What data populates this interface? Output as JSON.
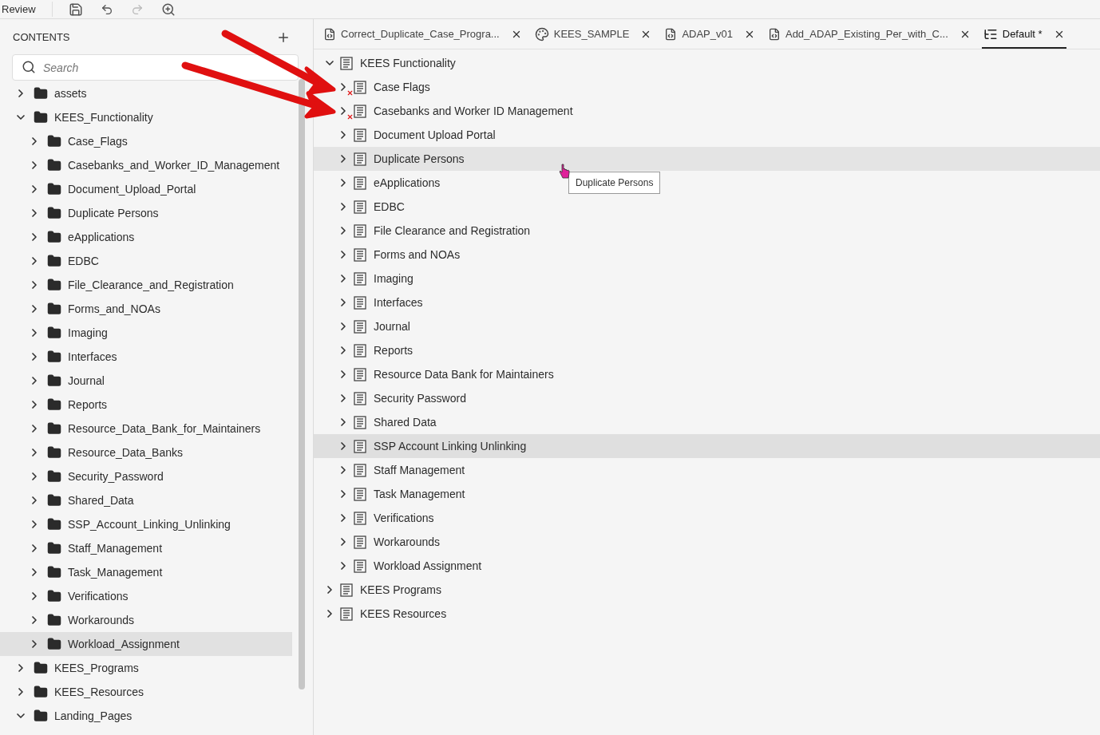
{
  "toolbar": {
    "label": "Review"
  },
  "contents": {
    "title": "CONTENTS",
    "search": {
      "placeholder": "Search"
    },
    "tree": [
      {
        "label": "assets",
        "expanded": false,
        "selected": false
      },
      {
        "label": "KEES_Functionality",
        "expanded": true,
        "selected": false,
        "children": [
          {
            "label": "Case_Flags",
            "expanded": false,
            "selected": false
          },
          {
            "label": "Casebanks_and_Worker_ID_Management",
            "expanded": false,
            "selected": false
          },
          {
            "label": "Document_Upload_Portal",
            "expanded": false,
            "selected": false
          },
          {
            "label": "Duplicate Persons",
            "expanded": false,
            "selected": false
          },
          {
            "label": "eApplications",
            "expanded": false,
            "selected": false
          },
          {
            "label": "EDBC",
            "expanded": false,
            "selected": false
          },
          {
            "label": "File_Clearance_and_Registration",
            "expanded": false,
            "selected": false
          },
          {
            "label": "Forms_and_NOAs",
            "expanded": false,
            "selected": false
          },
          {
            "label": "Imaging",
            "expanded": false,
            "selected": false
          },
          {
            "label": "Interfaces",
            "expanded": false,
            "selected": false
          },
          {
            "label": "Journal",
            "expanded": false,
            "selected": false
          },
          {
            "label": "Reports",
            "expanded": false,
            "selected": false
          },
          {
            "label": "Resource_Data_Bank_for_Maintainers",
            "expanded": false,
            "selected": false
          },
          {
            "label": "Resource_Data_Banks",
            "expanded": false,
            "selected": false
          },
          {
            "label": "Security_Password",
            "expanded": false,
            "selected": false
          },
          {
            "label": "Shared_Data",
            "expanded": false,
            "selected": false
          },
          {
            "label": "SSP_Account_Linking_Unlinking",
            "expanded": false,
            "selected": false
          },
          {
            "label": "Staff_Management",
            "expanded": false,
            "selected": false
          },
          {
            "label": "Task_Management",
            "expanded": false,
            "selected": false
          },
          {
            "label": "Verifications",
            "expanded": false,
            "selected": false
          },
          {
            "label": "Workarounds",
            "expanded": false,
            "selected": false
          },
          {
            "label": "Workload_Assignment",
            "expanded": false,
            "selected": true
          }
        ]
      },
      {
        "label": "KEES_Programs",
        "expanded": false,
        "selected": false
      },
      {
        "label": "KEES_Resources",
        "expanded": false,
        "selected": false
      },
      {
        "label": "Landing_Pages",
        "expanded": true,
        "selected": false
      }
    ]
  },
  "tabs": [
    {
      "label": "Correct_Duplicate_Case_Progra...",
      "kind": "html",
      "selected": false
    },
    {
      "label": "KEES_SAMPLE",
      "kind": "style",
      "selected": false
    },
    {
      "label": "ADAP_v01",
      "kind": "html",
      "selected": false
    },
    {
      "label": "Add_ADAP_Existing_Per_with_C...",
      "kind": "html",
      "selected": false
    },
    {
      "label": "Default *",
      "kind": "toc",
      "selected": true
    }
  ],
  "toc_tree": [
    {
      "label": "KEES Functionality",
      "expanded": true,
      "selected": false,
      "hovered": false,
      "error": false,
      "children": [
        {
          "label": "Case Flags",
          "expanded": false,
          "selected": false,
          "hovered": false,
          "error": true
        },
        {
          "label": "Casebanks and Worker ID Management",
          "expanded": false,
          "selected": false,
          "hovered": false,
          "error": true
        },
        {
          "label": "Document Upload Portal",
          "expanded": false,
          "selected": false,
          "hovered": false,
          "error": false
        },
        {
          "label": "Duplicate Persons",
          "expanded": false,
          "selected": false,
          "hovered": true,
          "error": false
        },
        {
          "label": "eApplications",
          "expanded": false,
          "selected": false,
          "hovered": false,
          "error": false
        },
        {
          "label": "EDBC",
          "expanded": false,
          "selected": false,
          "hovered": false,
          "error": false
        },
        {
          "label": "File Clearance and Registration",
          "expanded": false,
          "selected": false,
          "hovered": false,
          "error": false
        },
        {
          "label": "Forms and NOAs",
          "expanded": false,
          "selected": false,
          "hovered": false,
          "error": false
        },
        {
          "label": "Imaging",
          "expanded": false,
          "selected": false,
          "hovered": false,
          "error": false
        },
        {
          "label": "Interfaces",
          "expanded": false,
          "selected": false,
          "hovered": false,
          "error": false
        },
        {
          "label": "Journal",
          "expanded": false,
          "selected": false,
          "hovered": false,
          "error": false
        },
        {
          "label": "Reports",
          "expanded": false,
          "selected": false,
          "hovered": false,
          "error": false
        },
        {
          "label": "Resource Data Bank for Maintainers",
          "expanded": false,
          "selected": false,
          "hovered": false,
          "error": false
        },
        {
          "label": "Security Password",
          "expanded": false,
          "selected": false,
          "hovered": false,
          "error": false
        },
        {
          "label": "Shared Data",
          "expanded": false,
          "selected": false,
          "hovered": false,
          "error": false
        },
        {
          "label": "SSP Account Linking Unlinking",
          "expanded": false,
          "selected": true,
          "hovered": false,
          "error": false
        },
        {
          "label": "Staff Management",
          "expanded": false,
          "selected": false,
          "hovered": false,
          "error": false
        },
        {
          "label": "Task Management",
          "expanded": false,
          "selected": false,
          "hovered": false,
          "error": false
        },
        {
          "label": "Verifications",
          "expanded": false,
          "selected": false,
          "hovered": false,
          "error": false
        },
        {
          "label": "Workarounds",
          "expanded": false,
          "selected": false,
          "hovered": false,
          "error": false
        },
        {
          "label": "Workload Assignment",
          "expanded": false,
          "selected": false,
          "hovered": false,
          "error": false
        }
      ]
    },
    {
      "label": "KEES Programs",
      "expanded": false,
      "selected": false,
      "hovered": false,
      "error": false
    },
    {
      "label": "KEES Resources",
      "expanded": false,
      "selected": false,
      "hovered": false,
      "error": false
    }
  ],
  "tooltip": {
    "text": "Duplicate Persons"
  }
}
